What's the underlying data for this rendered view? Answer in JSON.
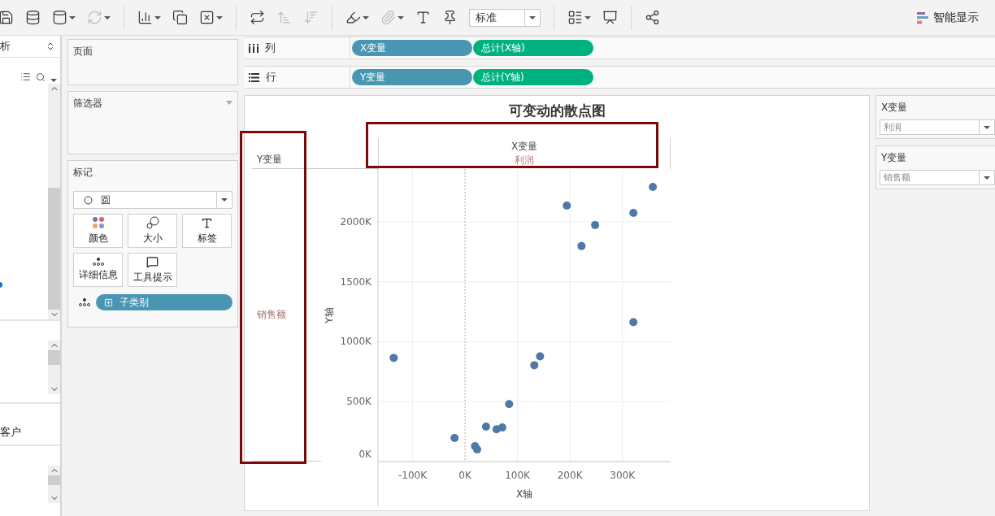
{
  "toolbar": {
    "items": [
      {
        "kind": "save",
        "disabled": false,
        "menu": false
      },
      {
        "kind": "new-source",
        "disabled": false,
        "menu": false
      },
      {
        "kind": "pause-source",
        "disabled": false,
        "menu": true
      },
      {
        "kind": "refresh",
        "disabled": true,
        "menu": true
      },
      {
        "kind": "separator"
      },
      {
        "kind": "new-sheet",
        "disabled": false,
        "menu": true
      },
      {
        "kind": "duplicate",
        "disabled": false,
        "menu": false
      },
      {
        "kind": "clear",
        "disabled": false,
        "menu": true
      },
      {
        "kind": "separator"
      },
      {
        "kind": "swap",
        "disabled": false,
        "menu": false
      },
      {
        "kind": "sort-asc",
        "disabled": true,
        "menu": false
      },
      {
        "kind": "sort-desc",
        "disabled": true,
        "menu": false
      },
      {
        "kind": "separator"
      },
      {
        "kind": "highlight",
        "disabled": false,
        "menu": true
      },
      {
        "kind": "clip",
        "disabled": true,
        "menu": true
      },
      {
        "kind": "label",
        "disabled": false,
        "menu": false
      },
      {
        "kind": "pin",
        "disabled": false,
        "menu": false
      },
      {
        "kind": "select",
        "value": "标准"
      },
      {
        "kind": "separator"
      },
      {
        "kind": "chart",
        "disabled": false,
        "menu": true
      },
      {
        "kind": "present",
        "disabled": false,
        "menu": false
      },
      {
        "kind": "separator"
      },
      {
        "kind": "share",
        "disabled": false,
        "menu": false
      }
    ],
    "show_me": "智能显示"
  },
  "data_pane": {
    "header": "析",
    "list_item": "客户"
  },
  "pages_card": {
    "title": "页面"
  },
  "filters_card": {
    "title": "筛选器"
  },
  "marks_card": {
    "title": "标记",
    "mark_type": "圆",
    "buttons": [
      {
        "label": "颜色",
        "kind": "color"
      },
      {
        "label": "大小",
        "kind": "size"
      },
      {
        "label": "标签",
        "kind": "label"
      },
      {
        "label": "详细信息",
        "kind": "detail"
      },
      {
        "label": "工具提示",
        "kind": "tooltip"
      }
    ],
    "pills": [
      {
        "label": "子类别",
        "kind": "detail"
      }
    ]
  },
  "shelves": [
    {
      "label": "列",
      "kind": "columns",
      "pills": [
        {
          "label": "X变量",
          "kind": "parameter"
        },
        {
          "label": "总计(X轴)",
          "kind": "measure"
        }
      ]
    },
    {
      "label": "行",
      "kind": "rows",
      "pills": [
        {
          "label": "Y变量",
          "kind": "parameter"
        },
        {
          "label": "总计(Y轴)",
          "kind": "measure"
        }
      ]
    }
  ],
  "view": {
    "title": "可变动的散点图",
    "column_header": "X变量",
    "column_value": "利润",
    "row_header": "Y变量",
    "row_value": "销售额",
    "chart_data": {
      "type": "scatter",
      "grid": true,
      "ref_lines": [
        {
          "axis": "x",
          "value": 0
        }
      ],
      "xlabel": "X轴",
      "ylabel": "Y轴",
      "x": [
        -136,
        -20,
        19,
        23,
        40,
        60,
        71,
        84,
        132,
        143,
        194,
        222,
        248,
        321,
        321,
        358
      ],
      "series": [
        {
          "color": "#4e79a7",
          "values": [
            865,
            196,
            128,
            101,
            291,
            270,
            284,
            480,
            804,
            878,
            2135,
            1797,
            1973,
            2074,
            1162,
            2291
          ]
        }
      ],
      "xlim": [
        -166,
        392
      ],
      "ylim": [
        0,
        2440
      ],
      "xticks": [
        {
          "value": -100,
          "label": "-100K"
        },
        {
          "value": 0,
          "label": "0K"
        },
        {
          "value": 100,
          "label": "100K"
        },
        {
          "value": 200,
          "label": "200K"
        },
        {
          "value": 300,
          "label": "300K"
        }
      ],
      "yticks": [
        {
          "value": 0,
          "label": "0K"
        },
        {
          "value": 500,
          "label": "500K"
        },
        {
          "value": 1000,
          "label": "1000K"
        },
        {
          "value": 1500,
          "label": "1500K"
        },
        {
          "value": 2000,
          "label": "2000K"
        }
      ]
    }
  },
  "parameters": [
    {
      "title": "X变量",
      "value": "利润"
    },
    {
      "title": "Y变量",
      "value": "销售额"
    }
  ]
}
